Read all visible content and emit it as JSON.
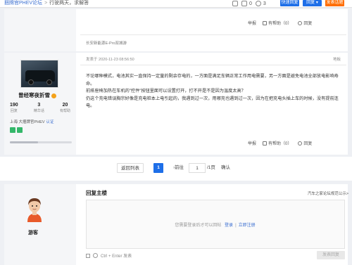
{
  "topbar": {
    "crumb_forum": "捆牌官PHEV论坛",
    "crumb_sep": ">",
    "crumb_title": "行驶两天，求解答",
    "icon_count_1": "0",
    "icon_count_2": "3",
    "quick_reply": "快速回复",
    "reply": "回复 ▾",
    "post": "发表话题"
  },
  "post1": {
    "actions": {
      "report": "举报",
      "helpful": "有帮助（0）",
      "reply": "回复"
    },
    "signature": "长安新能源E-Pro双城游"
  },
  "post2": {
    "meta": "发表于 2020-11-23 08:56:50",
    "floor": "地板",
    "user": {
      "name": "曾经寒夜折雪",
      "stats": [
        {
          "value": "190",
          "label": "回复"
        },
        {
          "value": "3",
          "label": "精华话"
        },
        {
          "value": "20",
          "label": "有帮助"
        }
      ],
      "location": "上海",
      "owner": "大捆牌官PHEV",
      "cert": "认证"
    },
    "body": [
      "不论哪种模式，电池其实一直保持一定量的剩余存电的，一方面是满足车辆正常工作用电需要，另一方面是避免电池全部放电影响寿命。",
      "前排座椅加热在车机的”控件”按钮里面可以设置打开，打不开是不是因为温度太高？",
      "仍这个充电错误胸宗好像是充电桩本上电引起的，我遇到过一次，用哪充也遇到过一次，因为在把充电头插上车的时候，没有提前连电。"
    ],
    "actions": {
      "report": "举报",
      "helpful": "有帮助（0）",
      "reply": "回复"
    }
  },
  "pagination": {
    "prev": "返回列表",
    "current": "1",
    "next": "›",
    "goto": "前往",
    "input_value": "1",
    "total": "/1页",
    "confirm": "确认"
  },
  "reply": {
    "title": "回复主楼",
    "rule": "汽车之家论坛规范公示>",
    "hint": "您需要登录后才可以回帖",
    "login": "登录",
    "sep": "|",
    "register": "立即注册",
    "shortcut": "Ctrl + Enter 发表",
    "submit": "发表回复",
    "guest": "游客"
  }
}
